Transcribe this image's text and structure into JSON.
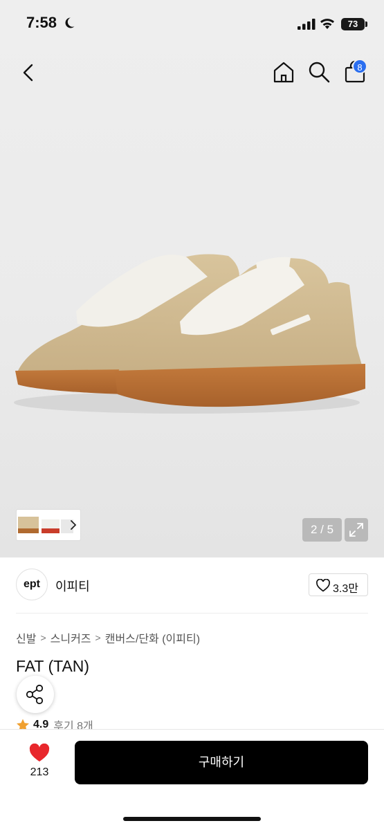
{
  "status_bar": {
    "time": "7:58",
    "battery": "73"
  },
  "nav": {
    "back_icon": "chevron-left-icon",
    "home_icon": "home-icon",
    "search_icon": "search-icon",
    "cart_icon": "shopping-bag-icon",
    "cart_badge": "8"
  },
  "gallery": {
    "page_counter": "2 / 5",
    "expand_icon": "expand-icon"
  },
  "brand": {
    "logo_text": "ept",
    "name": "이피티",
    "like_count": "3.3만"
  },
  "breadcrumb": [
    "신발",
    "스니커즈",
    "캔버스/단화 (이피티)"
  ],
  "product": {
    "title": "FAT (TAN)",
    "rating": "4.9",
    "reviews": "후기 8개"
  },
  "bottom_bar": {
    "wish_count": "213",
    "buy_label": "구매하기"
  },
  "colors": {
    "accent_badge": "#2a6ef0",
    "wish_heart": "#e8272c",
    "star": "#f0a030",
    "buy_button": "#000000"
  }
}
